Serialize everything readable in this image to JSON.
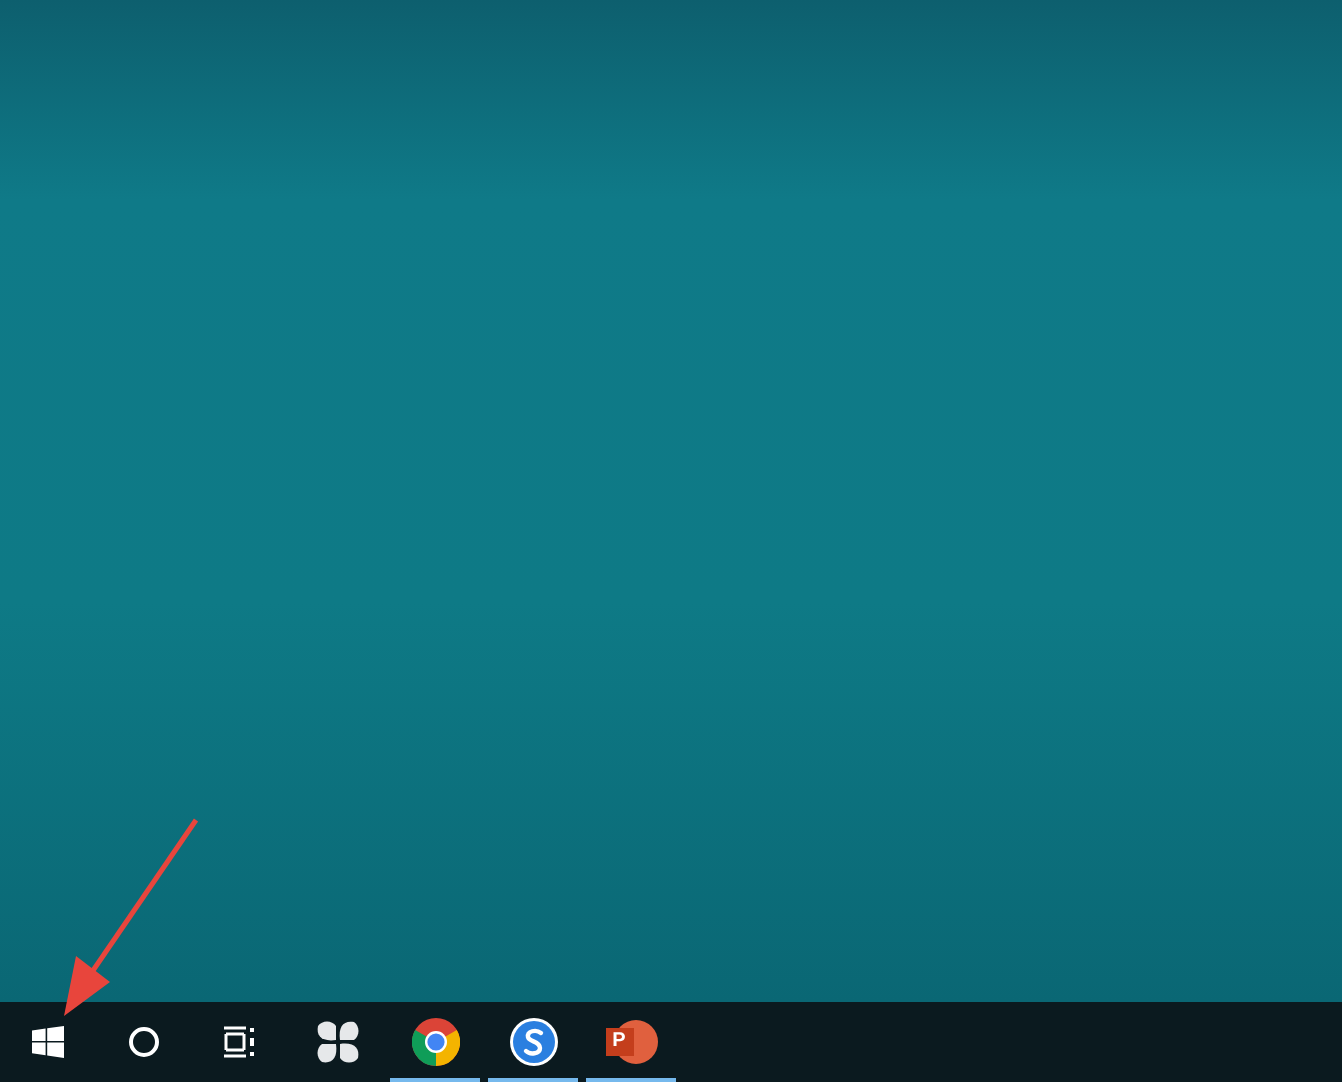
{
  "taskbar": {
    "apps": [
      {
        "kind": "fan",
        "running": false
      },
      {
        "kind": "chrome",
        "running": true
      },
      {
        "kind": "sbrowser",
        "running": true
      },
      {
        "kind": "powerpoint",
        "running": true,
        "letter": "P"
      }
    ]
  },
  "annotation": {
    "kind": "arrow"
  }
}
